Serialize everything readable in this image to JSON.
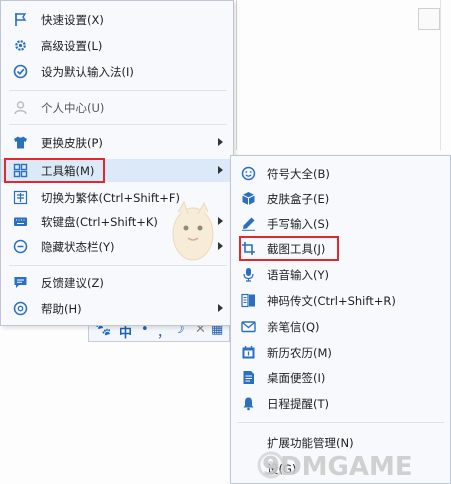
{
  "main_menu": {
    "items": [
      {
        "label": "快速设置(X)",
        "icon": "flag-icon"
      },
      {
        "label": "高级设置(L)",
        "icon": "gear-icon"
      },
      {
        "label": "设为默认输入法(I)",
        "icon": "check-circle-icon"
      },
      {
        "label": "个人中心(U)",
        "icon": "user-icon"
      },
      {
        "label": "更换皮肤(P)",
        "icon": "tshirt-icon"
      },
      {
        "label": "工具箱(M)",
        "icon": "grid-icon"
      },
      {
        "label": "切换为繁体(Ctrl+Shift+F)",
        "icon": "traditional-char-icon"
      },
      {
        "label": "软键盘(Ctrl+Shift+K)",
        "icon": "keyboard-icon"
      },
      {
        "label": "隐藏状态栏(Y)",
        "icon": "hide-circle-icon"
      },
      {
        "label": "反馈建议(Z)",
        "icon": "feedback-icon"
      },
      {
        "label": "帮助(H)",
        "icon": "help-icon"
      }
    ]
  },
  "submenu": {
    "items": [
      {
        "label": "符号大全(B)",
        "icon": "smiley-icon"
      },
      {
        "label": "皮肤盒子(E)",
        "icon": "box-icon"
      },
      {
        "label": "手写输入(S)",
        "icon": "pen-icon"
      },
      {
        "label": "截图工具(J)",
        "icon": "crop-icon"
      },
      {
        "label": "语音输入(Y)",
        "icon": "microphone-icon"
      },
      {
        "label": "神码传文(Ctrl+Shift+R)",
        "icon": "transfer-icon"
      },
      {
        "label": "亲笔信(Q)",
        "icon": "envelope-icon"
      },
      {
        "label": "新历农历(M)",
        "icon": "calendar-icon"
      },
      {
        "label": "桌面便签(I)",
        "icon": "note-icon"
      },
      {
        "label": "日程提醒(T)",
        "icon": "bell-icon"
      },
      {
        "label": "扩展功能管理(N)",
        "icon": ""
      },
      {
        "label": "设(G)",
        "icon": ""
      }
    ]
  },
  "toolbar_strip": {
    "glyphs": [
      "中",
      "•",
      "，",
      "☽",
      "✕",
      "▦"
    ]
  },
  "watermark": {
    "text": "9DMGAME"
  },
  "colors": {
    "highlight": "#dce9f8",
    "accent_blue": "#2a6fc2",
    "red_box": "#e0282e"
  }
}
